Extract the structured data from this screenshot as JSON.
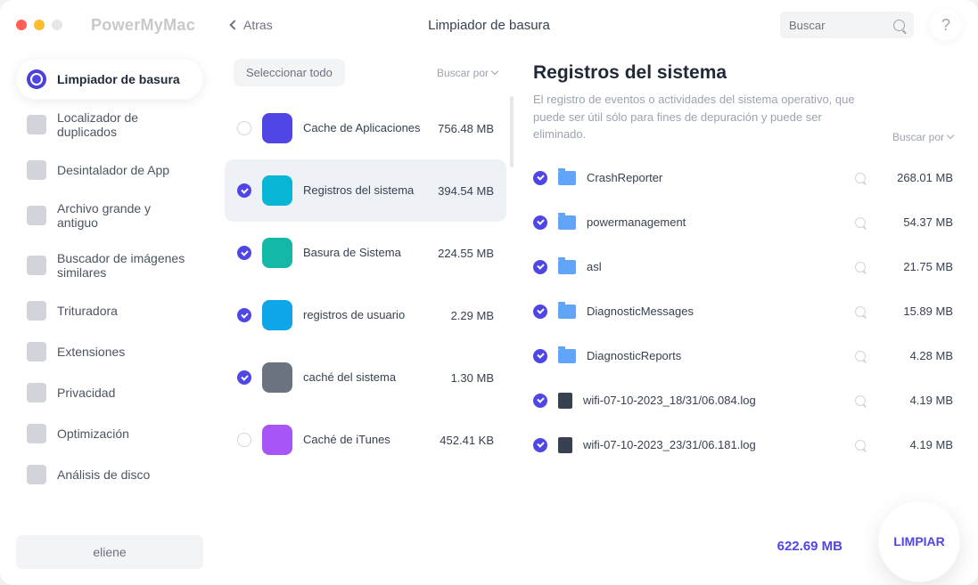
{
  "app_name": "PowerMyMac",
  "back_label": "Atras",
  "title_center": "Limpiador de basura",
  "search_placeholder": "Buscar",
  "help_label": "?",
  "sidebar": {
    "tools": [
      {
        "label": "Limpiador de basura"
      },
      {
        "label": "Localizador de duplicados"
      },
      {
        "label": "Desintalador de App"
      },
      {
        "label": "Archivo grande y antiguo"
      },
      {
        "label": "Buscador de imágenes similares"
      },
      {
        "label": "Trituradora"
      },
      {
        "label": "Extensiones"
      },
      {
        "label": "Privacidad"
      },
      {
        "label": "Optimización"
      },
      {
        "label": "Análisis de disco"
      }
    ],
    "user": "eliene"
  },
  "mid": {
    "select_all": "Seleccionar todo",
    "search_by": "Buscar por",
    "categories": [
      {
        "name": "Cache de Aplicaciones",
        "size": "756.48 MB",
        "icon_bg": "#4f46e5",
        "checked": false
      },
      {
        "name": "Registros del sistema",
        "size": "394.54 MB",
        "icon_bg": "#06b6d4",
        "checked": true,
        "selected": true
      },
      {
        "name": "Basura de Sistema",
        "size": "224.55 MB",
        "icon_bg": "#14b8a6",
        "checked": true
      },
      {
        "name": "registros de usuario",
        "size": "2.29 MB",
        "icon_bg": "#0ea5e9",
        "checked": true
      },
      {
        "name": "caché del sistema",
        "size": "1.30 MB",
        "icon_bg": "#6b7280",
        "checked": true
      },
      {
        "name": "Caché de iTunes",
        "size": "452.41 KB",
        "icon_bg": "#a855f7",
        "checked": false
      }
    ]
  },
  "detail": {
    "title": "Registros del sistema",
    "description": "El registro de eventos o actividades del sistema operativo, que puede ser útil sólo para fines de depuración y puede ser eliminado.",
    "search_by": "Buscar por",
    "items": [
      {
        "name": "CrashReporter",
        "size": "268.01 MB",
        "icon": "folder",
        "checked": true
      },
      {
        "name": "powermanagement",
        "size": "54.37 MB",
        "icon": "folder",
        "checked": true
      },
      {
        "name": "asl",
        "size": "21.75 MB",
        "icon": "folder",
        "checked": true
      },
      {
        "name": "DiagnosticMessages",
        "size": "15.89 MB",
        "icon": "folder",
        "checked": true
      },
      {
        "name": "DiagnosticReports",
        "size": "4.28 MB",
        "icon": "folder",
        "checked": true
      },
      {
        "name": "wifi-07-10-2023_18/31/06.084.log",
        "size": "4.19 MB",
        "icon": "file",
        "checked": true
      },
      {
        "name": "wifi-07-10-2023_23/31/06.181.log",
        "size": "4.19 MB",
        "icon": "file",
        "checked": true
      }
    ]
  },
  "footer": {
    "total": "622.69 MB",
    "clean_label": "LIMPIAR"
  }
}
